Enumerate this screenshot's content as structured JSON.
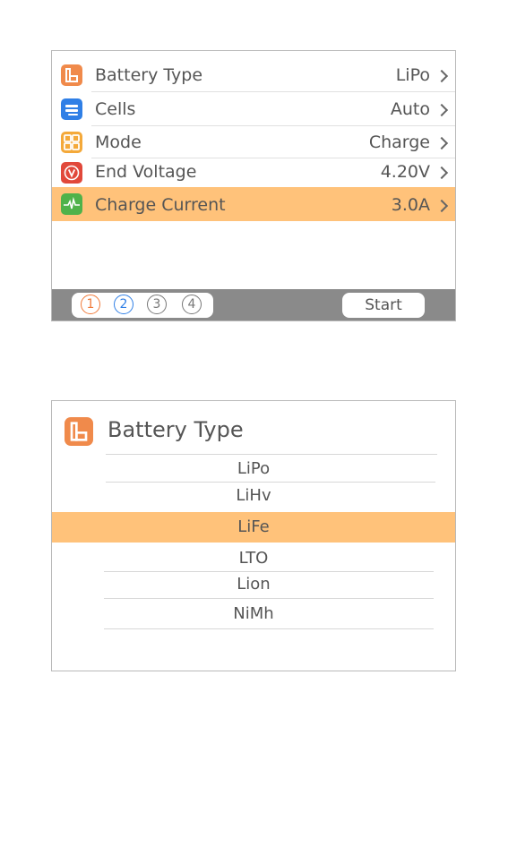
{
  "settings": {
    "items": [
      {
        "label": "Battery Type",
        "value": "LiPo",
        "icon": "battery-icon",
        "color": "#f08a4b"
      },
      {
        "label": "Cells",
        "value": "Auto",
        "icon": "cells-icon",
        "color": "#2f7fe6"
      },
      {
        "label": "Mode",
        "value": "Charge",
        "icon": "mode-grid-icon",
        "color": "#f4a93a"
      },
      {
        "label": "End Voltage",
        "value": "4.20V",
        "icon": "voltage-icon",
        "color": "#e1483a"
      },
      {
        "label": "Charge Current",
        "value": "3.0A",
        "icon": "current-waveform-icon",
        "color": "#4fb24a",
        "selected": true
      }
    ],
    "steps": [
      {
        "label": "1",
        "color": "#f07a3a"
      },
      {
        "label": "2",
        "color": "#2f7fe6"
      },
      {
        "label": "3",
        "color": "#777777"
      },
      {
        "label": "4",
        "color": "#777777"
      }
    ],
    "start_label": "Start"
  },
  "picker": {
    "title": "Battery Type",
    "options": [
      "LiPo",
      "LiHv",
      "LiFe",
      "LTO",
      "Lion",
      "NiMh"
    ],
    "selected": "LiFe",
    "highlight_color": "#ffc27a"
  }
}
